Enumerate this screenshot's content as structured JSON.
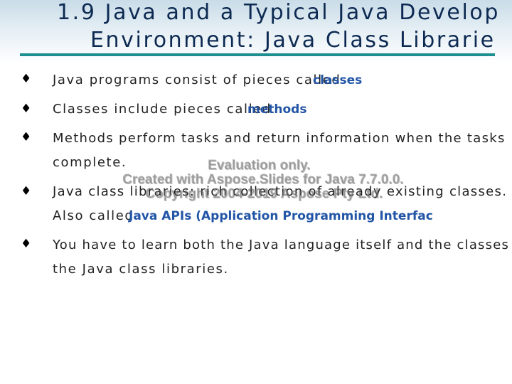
{
  "slide": {
    "title_line1": "1.9 Java and a Typical Java Develop",
    "title_line2": "Environment: Java Class Librarie"
  },
  "bullets": {
    "symbol": "♦",
    "b1": {
      "text": "Java programs consist of pieces called",
      "keyword": "classes"
    },
    "b2": {
      "text": "Classes include pieces called",
      "keyword": "methods"
    },
    "b3": {
      "text1": "Methods  perform  tasks  and  return  information  when  the  tasks",
      "text2": "complete."
    },
    "b4": {
      "text1": "Java  class  libraries: rich collection of  already  existing  classes.",
      "text2": "Also called",
      "keyword": "Java APIs (Application Programming Interfac"
    },
    "b5": {
      "text1": "You  have  to  learn  both  the  Java  language  itself  and  the  classes  in",
      "text2": "the Java class libraries."
    }
  },
  "watermark": {
    "line1": "Evaluation only.",
    "line2": "Created with Aspose.Slides for Java 7.7.0.0.",
    "line3": "Copyright 2004-2019 Aspose Pty Ltd."
  }
}
